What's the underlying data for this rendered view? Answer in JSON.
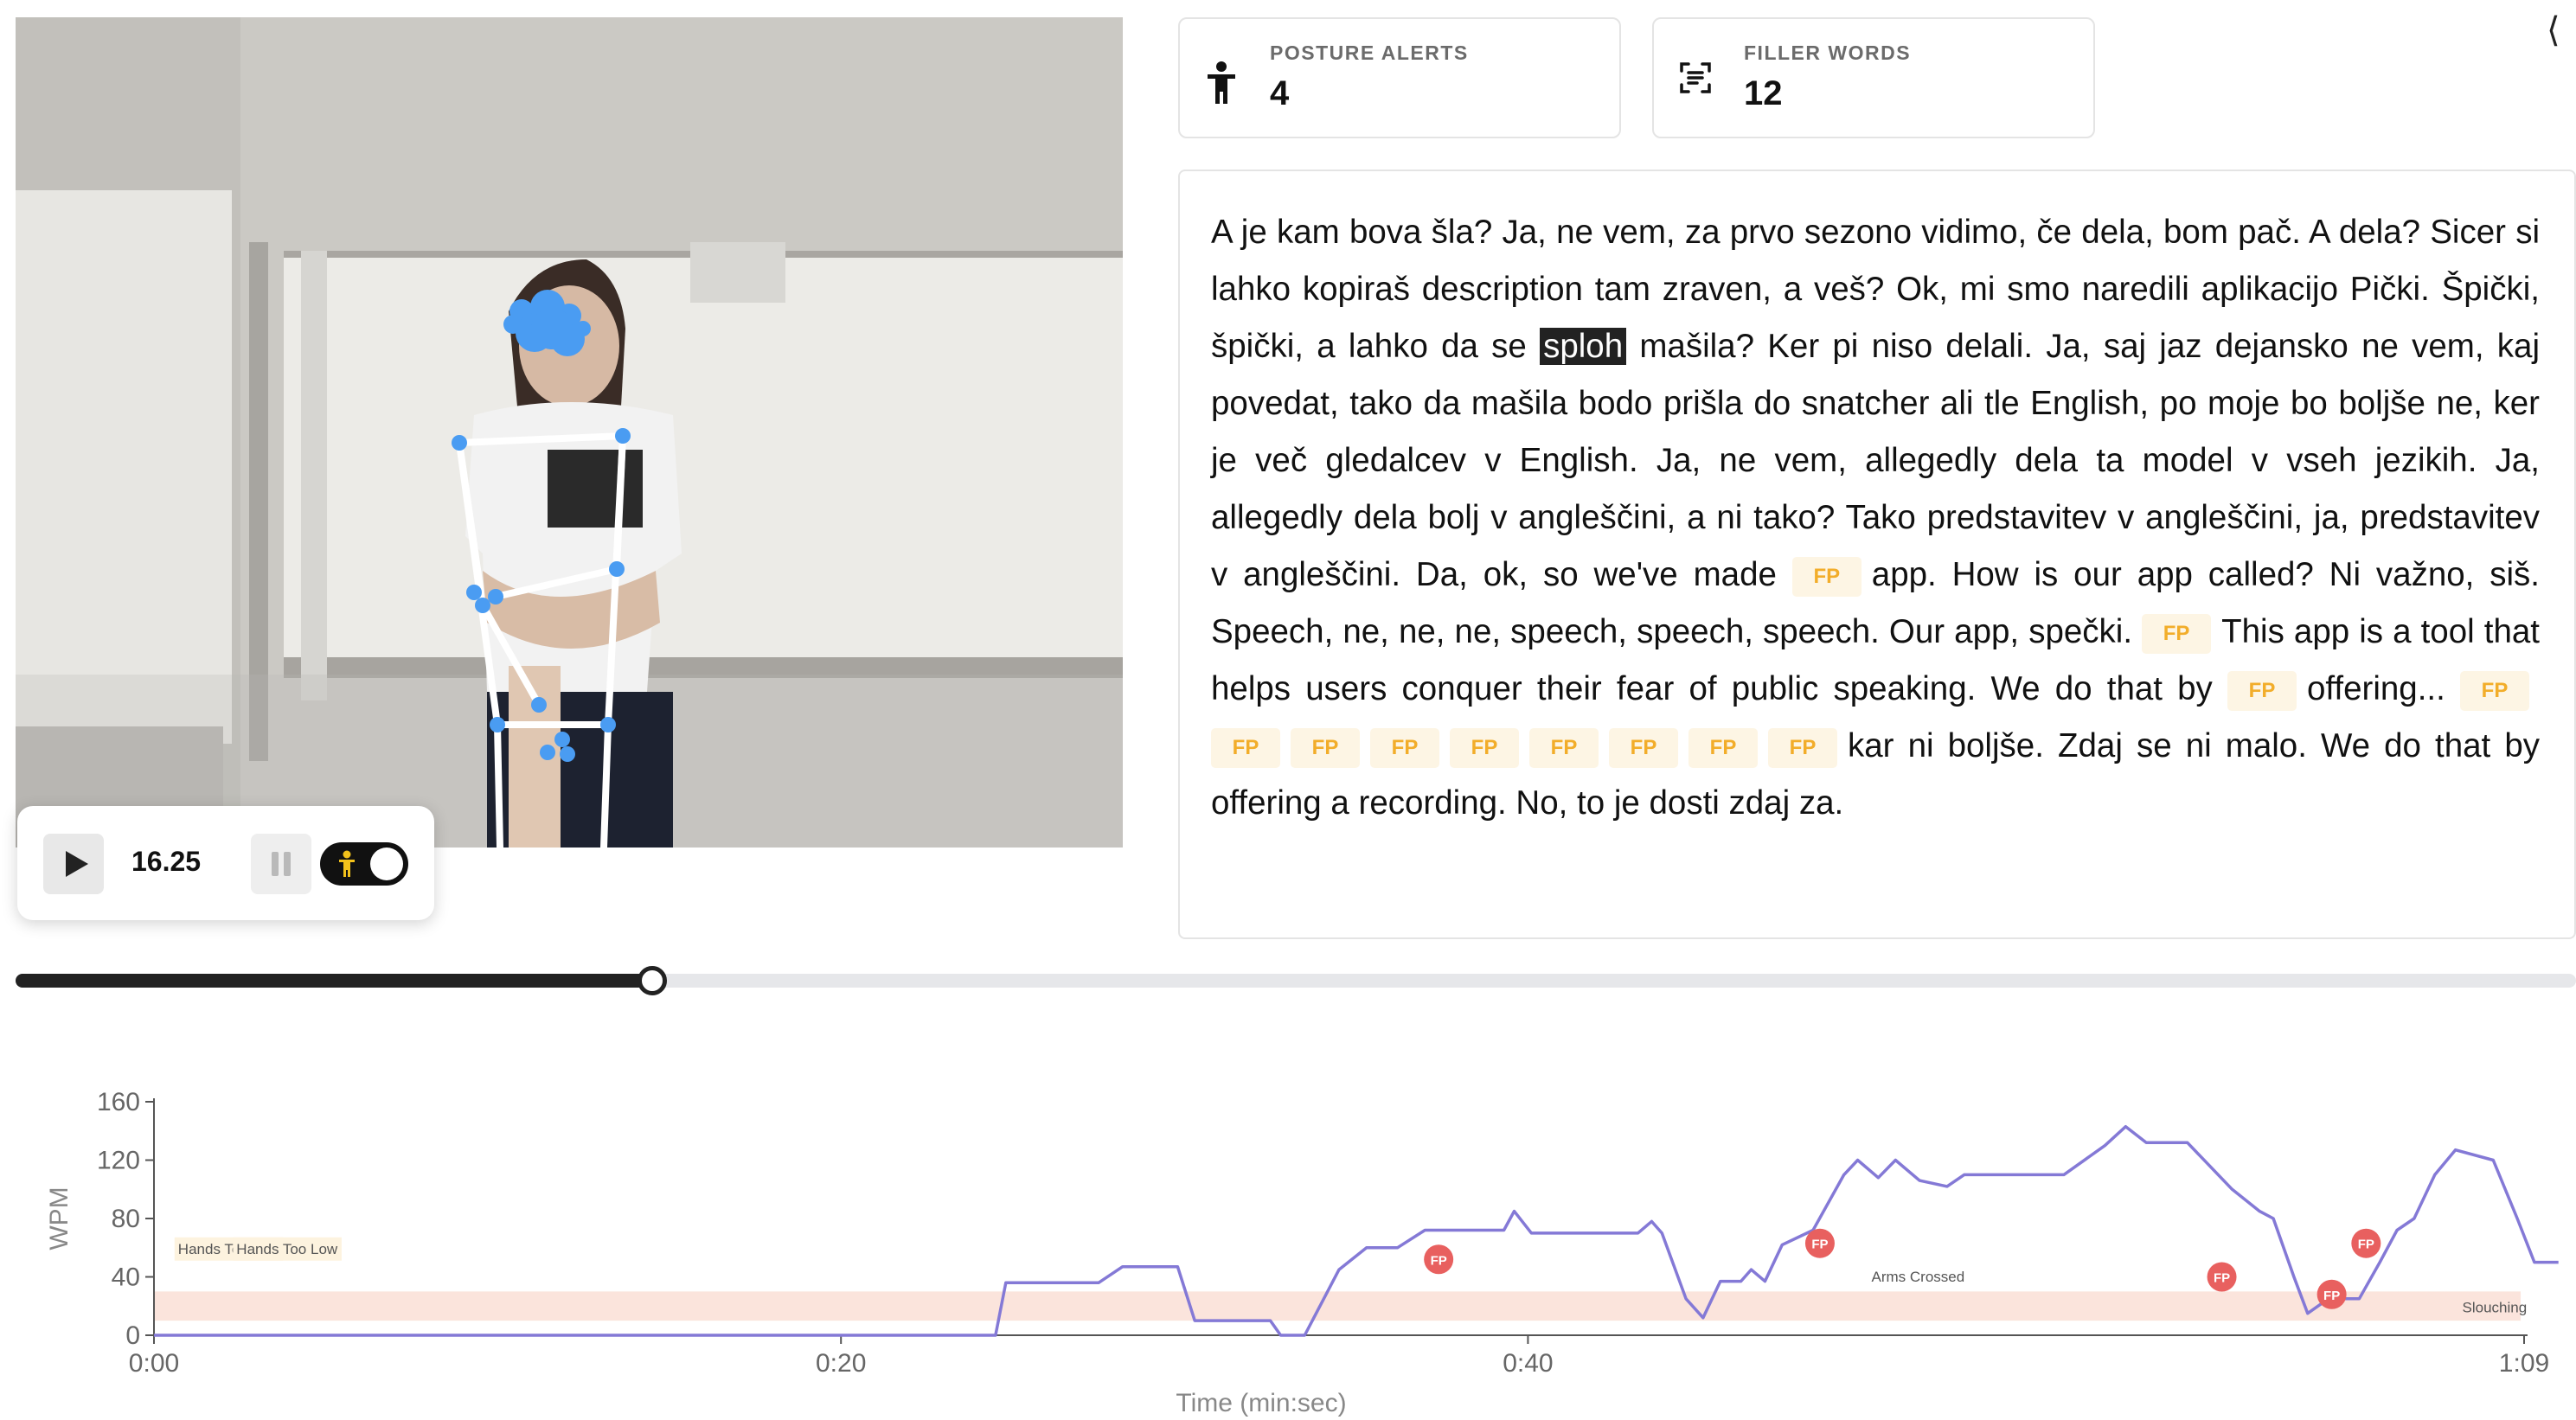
{
  "stats": {
    "posture_alerts": {
      "label": "POSTURE ALERTS",
      "value": "4",
      "icon": "person-icon"
    },
    "filler_words": {
      "label": "FILLER WORDS",
      "value": "12",
      "icon": "transcript-scan-icon"
    }
  },
  "collapse_label": "⟨",
  "player": {
    "time": "16.25",
    "progress_fraction": 0.248
  },
  "transcript": {
    "highlighted_word": "sploh",
    "filler_tag": "FP",
    "t1": "A je kam bova šla? Ja, ne vem, za prvo sezono vidimo, če dela, bom pač. A dela? Sicer si lahko kopiraš description tam zraven, a veš? Ok, mi smo naredili aplikacijo Pički. Špički, špički, a lahko da se ",
    "t2": " mašila? Ker pi niso delali. Ja, saj jaz dejansko ne vem, kaj povedat, tako da mašila bodo prišla do snatcher ali tle English, po moje bo boljše ne, ker je več gledalcev v English. Ja, ne vem, allegedly dela ta model v vseh jezikih. Ja, allegedly dela bolj v angleščini, a ni tako? Tako predstavitev v angleščini, ja, predstavitev v angleščini. Da, ok, so we've made ",
    "t3": "app. How is our app called? Ni važno, siš. Speech, ne, ne, ne, speech, speech, speech. Our app, spečki. ",
    "t4": "This app is a tool that helps users conquer their fear of public speaking. We do that by ",
    "t5": "offering... ",
    "t6": "kar ni boljše. Zdaj se ni malo. We do that by offering a recording. No, to je dosti zdaj za."
  },
  "chart_data": {
    "type": "line",
    "xlabel": "Time (min:sec)",
    "ylabel": "WPM",
    "ylim": [
      0,
      160
    ],
    "xlim": [
      0,
      69
    ],
    "x_ticks": [
      {
        "t": 0,
        "label": "0:00"
      },
      {
        "t": 20,
        "label": "0:20"
      },
      {
        "t": 40,
        "label": "0:40"
      },
      {
        "t": 69,
        "label": "1:09"
      }
    ],
    "y_ticks": [
      0,
      40,
      80,
      120,
      160
    ],
    "series": [
      {
        "color": "#8479d6",
        "points": [
          [
            0,
            0
          ],
          [
            24.5,
            0
          ],
          [
            24.8,
            36
          ],
          [
            27.5,
            36
          ],
          [
            28.2,
            47
          ],
          [
            29.8,
            47
          ],
          [
            30.3,
            10
          ],
          [
            32.5,
            10
          ],
          [
            32.8,
            0
          ],
          [
            33.5,
            0
          ],
          [
            34.5,
            45
          ],
          [
            35.3,
            60
          ],
          [
            36.2,
            60
          ],
          [
            37,
            72
          ],
          [
            39.3,
            72
          ],
          [
            39.6,
            85
          ],
          [
            40.1,
            70
          ],
          [
            41.5,
            70
          ],
          [
            43.2,
            70
          ],
          [
            43.6,
            78
          ],
          [
            43.9,
            70
          ],
          [
            44.6,
            25
          ],
          [
            45.1,
            12
          ],
          [
            45.6,
            37
          ],
          [
            46.2,
            37
          ],
          [
            46.5,
            45
          ],
          [
            46.9,
            37
          ],
          [
            47.4,
            62
          ],
          [
            48.3,
            72
          ],
          [
            49.2,
            110
          ],
          [
            49.6,
            120
          ],
          [
            50.2,
            108
          ],
          [
            50.7,
            120
          ],
          [
            51.4,
            106
          ],
          [
            52.2,
            102
          ],
          [
            52.7,
            110
          ],
          [
            54.7,
            110
          ],
          [
            55.6,
            110
          ],
          [
            56.8,
            130
          ],
          [
            57.4,
            143
          ],
          [
            58,
            132
          ],
          [
            59.2,
            132
          ],
          [
            60.5,
            100
          ],
          [
            61.3,
            85
          ],
          [
            61.7,
            80
          ],
          [
            62.3,
            40
          ],
          [
            62.7,
            15
          ],
          [
            63.3,
            25
          ],
          [
            64.2,
            25
          ],
          [
            64.8,
            50
          ],
          [
            65.3,
            72
          ],
          [
            65.8,
            80
          ],
          [
            66.4,
            110
          ],
          [
            67,
            127
          ],
          [
            68.1,
            120
          ],
          [
            68.8,
            80
          ],
          [
            69.3,
            50
          ],
          [
            70,
            50
          ]
        ]
      }
    ],
    "posture_band": {
      "from": 10,
      "to": 30,
      "color": "#fbe4dc"
    },
    "markers": [
      {
        "t": 37.4,
        "wpm": 52,
        "label": "FP"
      },
      {
        "t": 48.5,
        "wpm": 63,
        "label": "FP"
      },
      {
        "t": 60.2,
        "wpm": 40,
        "label": "FP"
      },
      {
        "t": 63.4,
        "wpm": 28,
        "label": "FP"
      },
      {
        "t": 64.4,
        "wpm": 63,
        "label": "FP"
      }
    ],
    "annotations": [
      {
        "t": 0.7,
        "wpm": 60,
        "text": "Hands Too Low"
      },
      {
        "t": 2.4,
        "wpm": 60,
        "text": "Hands Too Low"
      },
      {
        "t": 50.0,
        "wpm": 41,
        "text": "Arms Crossed"
      },
      {
        "t": 67.2,
        "wpm": 20,
        "text": "Slouching"
      }
    ]
  }
}
